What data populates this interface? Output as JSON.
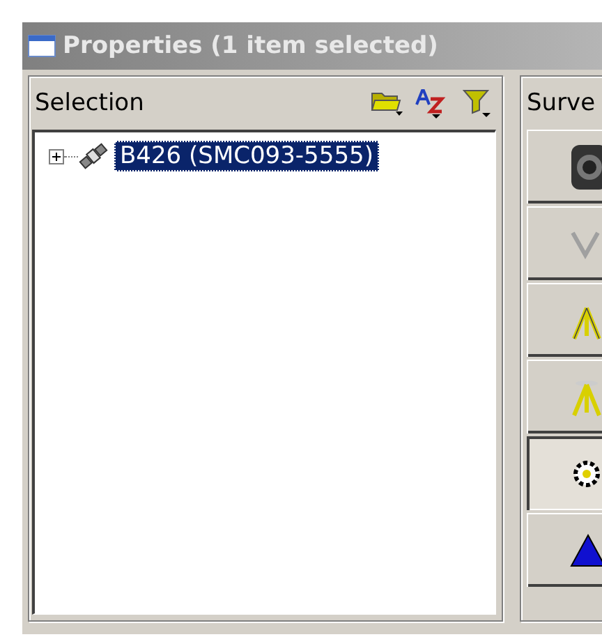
{
  "window": {
    "title": "Properties (1 item selected)"
  },
  "selection_panel": {
    "title": "Selection",
    "tree": [
      {
        "label": "B426 (SMC093-5555)",
        "expanded": false,
        "selected": true
      }
    ]
  },
  "survey_panel": {
    "title": "Surve",
    "buttons": [
      {
        "kind": "camera",
        "selected": false
      },
      {
        "kind": "letter",
        "selected": false
      },
      {
        "kind": "tripod",
        "selected": false
      },
      {
        "kind": "tripod-split",
        "selected": false
      },
      {
        "kind": "gear",
        "selected": true
      },
      {
        "kind": "triangle",
        "selected": false
      }
    ]
  }
}
